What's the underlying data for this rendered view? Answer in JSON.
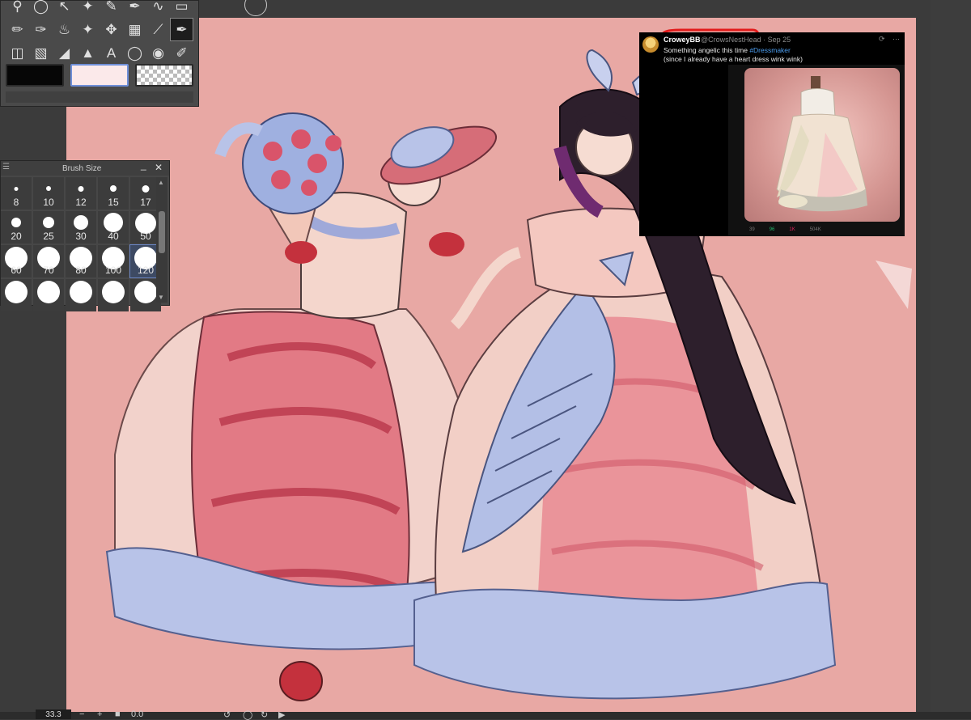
{
  "tool_palette": {
    "tools_row1": [
      "zoom-icon",
      "lasso-select-icon",
      "move-layer-icon",
      "magic-wand-icon",
      "eyedropper-icon",
      "pen-icon",
      "brush-icon",
      "eraser-icon"
    ],
    "tools_row2": [
      "pencil-icon",
      "marker-icon",
      "airbrush-icon",
      "sparkle-icon",
      "move-icon",
      "transform-icon",
      "line-icon",
      "pen-nib-icon"
    ],
    "tools_row3": [
      "frame-icon",
      "gradient-icon",
      "fill-triangle-icon",
      "fill-bucket-icon",
      "text-icon",
      "balloon-icon",
      "blend-icon",
      "paint-brush-icon"
    ],
    "text_tool_glyph": "A",
    "colors": {
      "main": "#060606",
      "sub": "#fbe9ea"
    }
  },
  "brush_panel": {
    "title": "Brush Size",
    "sizes": [
      {
        "label": "8",
        "dot": 5
      },
      {
        "label": "10",
        "dot": 6
      },
      {
        "label": "12",
        "dot": 7
      },
      {
        "label": "15",
        "dot": 8
      },
      {
        "label": "17",
        "dot": 9
      },
      {
        "label": "20",
        "dot": 12
      },
      {
        "label": "25",
        "dot": 14
      },
      {
        "label": "30",
        "dot": 18
      },
      {
        "label": "40",
        "dot": 24
      },
      {
        "label": "50",
        "dot": 26
      },
      {
        "label": "60",
        "dot": 28
      },
      {
        "label": "70",
        "dot": 28
      },
      {
        "label": "80",
        "dot": 28
      },
      {
        "label": "100",
        "dot": 28
      },
      {
        "label": "120",
        "dot": 28
      },
      {
        "label": "",
        "dot": 28
      },
      {
        "label": "",
        "dot": 28
      },
      {
        "label": "",
        "dot": 28
      },
      {
        "label": "",
        "dot": 28
      },
      {
        "label": "",
        "dot": 28
      }
    ],
    "selected": "120"
  },
  "tweet": {
    "name": "CroweyBB",
    "handle": "@CrowsNestHead · Sep 25",
    "text_prefix": "Something angelic this time ",
    "hashtag": "#Dressmaker",
    "text_line2": "(since I already have a heart dress wink wink)",
    "actions": {
      "replies": "39",
      "retweets": "96",
      "likes": "1K",
      "views": "504K"
    }
  },
  "status_bar": {
    "zoom": "33.3",
    "minus": "−",
    "plus": "+",
    "rotation": "0.0"
  },
  "colors": {
    "canvas_bg": "#e8a8a4",
    "workspace": "#3b3b3b",
    "panel": "#4a4a4a"
  }
}
